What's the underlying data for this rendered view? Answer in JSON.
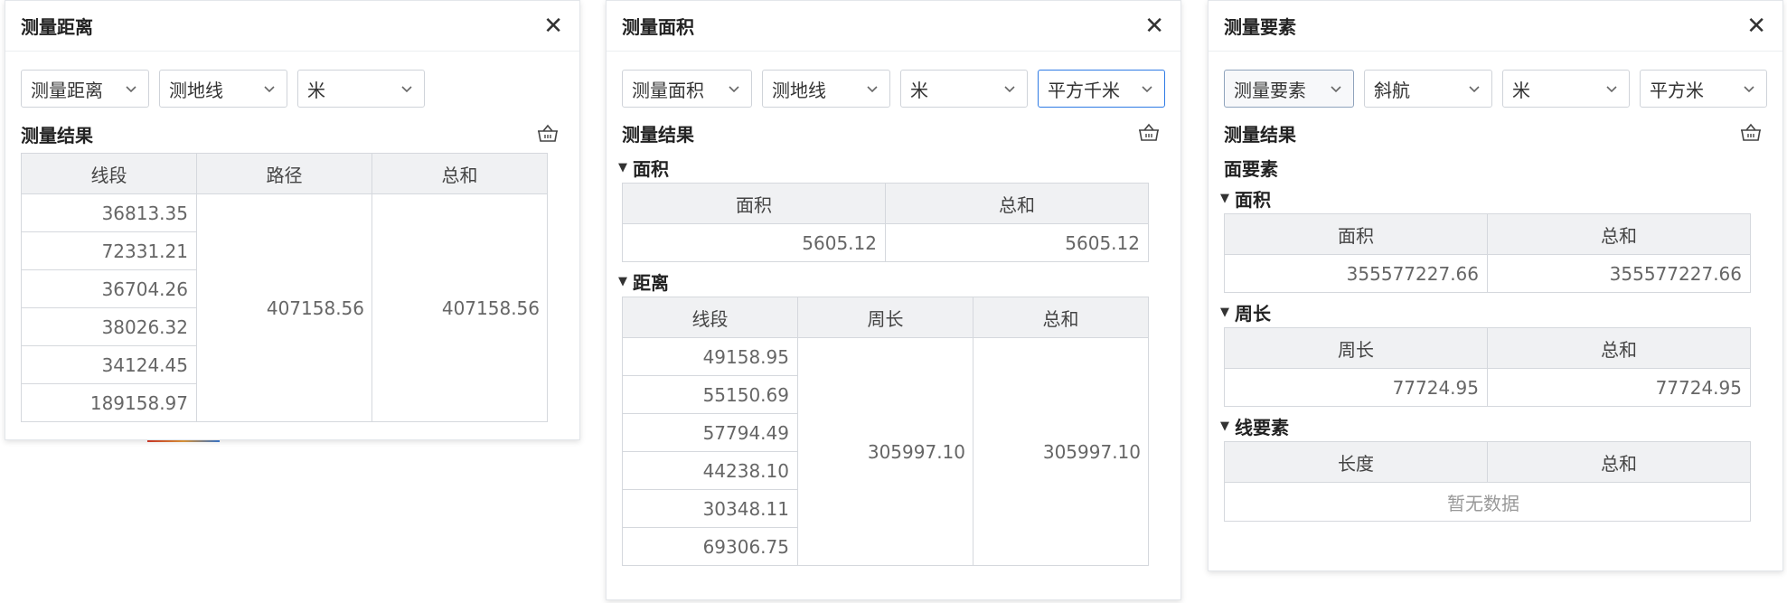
{
  "panel_distance": {
    "title": "测量距离",
    "selects": [
      "测量距离",
      "测地线",
      "米"
    ],
    "result_title": "测量结果",
    "table": {
      "headers": [
        "线段",
        "路径",
        "总和"
      ],
      "segments": [
        "36813.35",
        "72331.21",
        "36704.26",
        "38026.32",
        "34124.45",
        "189158.97"
      ],
      "path": "407158.56",
      "total": "407158.56"
    }
  },
  "panel_area": {
    "title": "测量面积",
    "selects": [
      "测量面积",
      "测地线",
      "米",
      "平方千米"
    ],
    "result_title": "测量结果",
    "area_section": {
      "label": "面积",
      "headers": [
        "面积",
        "总和"
      ],
      "row": [
        "5605.12",
        "5605.12"
      ]
    },
    "distance_section": {
      "label": "距离",
      "headers": [
        "线段",
        "周长",
        "总和"
      ],
      "segments": [
        "49158.95",
        "55150.69",
        "57794.49",
        "44238.10",
        "30348.11",
        "69306.75"
      ],
      "perimeter": "305997.10",
      "total": "305997.10"
    }
  },
  "panel_feature": {
    "title": "测量要素",
    "selects": [
      "测量要素",
      "斜航",
      "米",
      "平方米"
    ],
    "result_title": "测量结果",
    "polygon_label": "面要素",
    "area_section": {
      "label": "面积",
      "headers": [
        "面积",
        "总和"
      ],
      "row": [
        "355577227.66",
        "355577227.66"
      ]
    },
    "perimeter_section": {
      "label": "周长",
      "headers": [
        "周长",
        "总和"
      ],
      "row": [
        "77724.95",
        "77724.95"
      ]
    },
    "line_label": "线要素",
    "line_table": {
      "headers": [
        "长度",
        "总和"
      ],
      "empty_text": "暂无数据"
    }
  },
  "colors": {
    "active_border": "#2f7be5",
    "header_bg": "#f0f1f3",
    "border": "#d5d8dd"
  }
}
